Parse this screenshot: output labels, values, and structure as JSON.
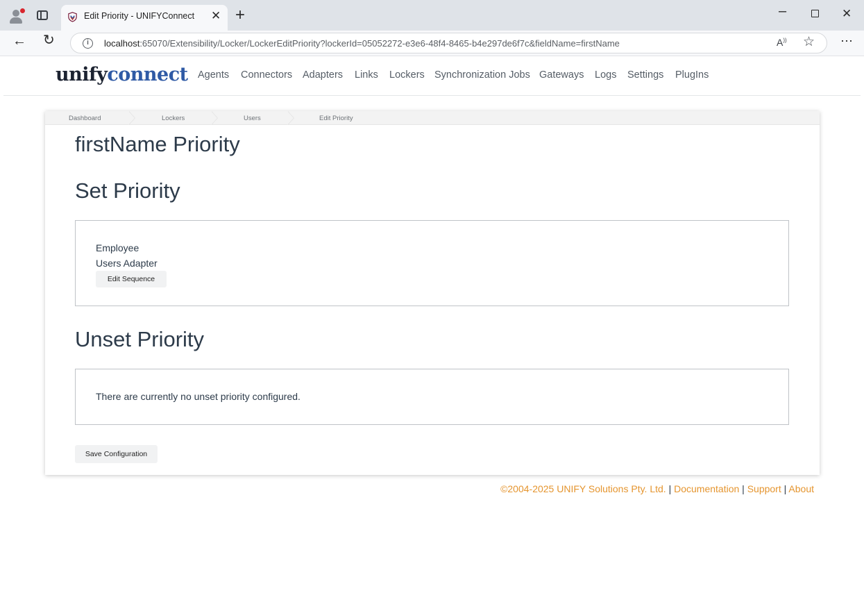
{
  "browser": {
    "tab_title": "Edit Priority - UNIFYConnect",
    "url_host": "localhost",
    "url_rest": ":65070/Extensibility/Locker/LockerEditPriority?lockerId=05052272-e3e6-48f4-8465-b4e297de6f7c&fieldName=firstName",
    "icons": [
      "profile-icon",
      "tab-actions-icon",
      "close-icon",
      "plus-icon",
      "minimize-icon",
      "maximize-icon",
      "close-icon",
      "back-arrow-icon",
      "reload-icon",
      "info-icon",
      "read-aloud-icon",
      "star-icon",
      "more-menu-icon"
    ]
  },
  "app": {
    "logo_part1": "unify",
    "logo_part2": "connect",
    "logo_colors": {
      "dark": "#1c2331",
      "blue": "#2f5aa5"
    },
    "nav": [
      "Agents",
      "Connectors",
      "Adapters",
      "Links",
      "Lockers",
      "Synchronization Jobs",
      "Gateways",
      "Logs",
      "Settings",
      "PlugIns"
    ]
  },
  "breadcrumb": [
    "Dashboard",
    "Lockers",
    "Users",
    "Edit Priority"
  ],
  "main": {
    "title": "firstName Priority",
    "set_priority": {
      "heading": "Set Priority",
      "line1": "Employee",
      "line2": "Users Adapter",
      "button": "Edit Sequence"
    },
    "unset_priority": {
      "heading": "Unset Priority",
      "message": "There are currently no unset priority configured."
    },
    "save_button": "Save Configuration"
  },
  "footer": {
    "copyright": "©2004-2025 UNIFY Solutions Pty. Ltd.",
    "separator": "|",
    "documentation": "Documentation",
    "support": "Support",
    "about": "About",
    "link_color": "#e5952f"
  }
}
